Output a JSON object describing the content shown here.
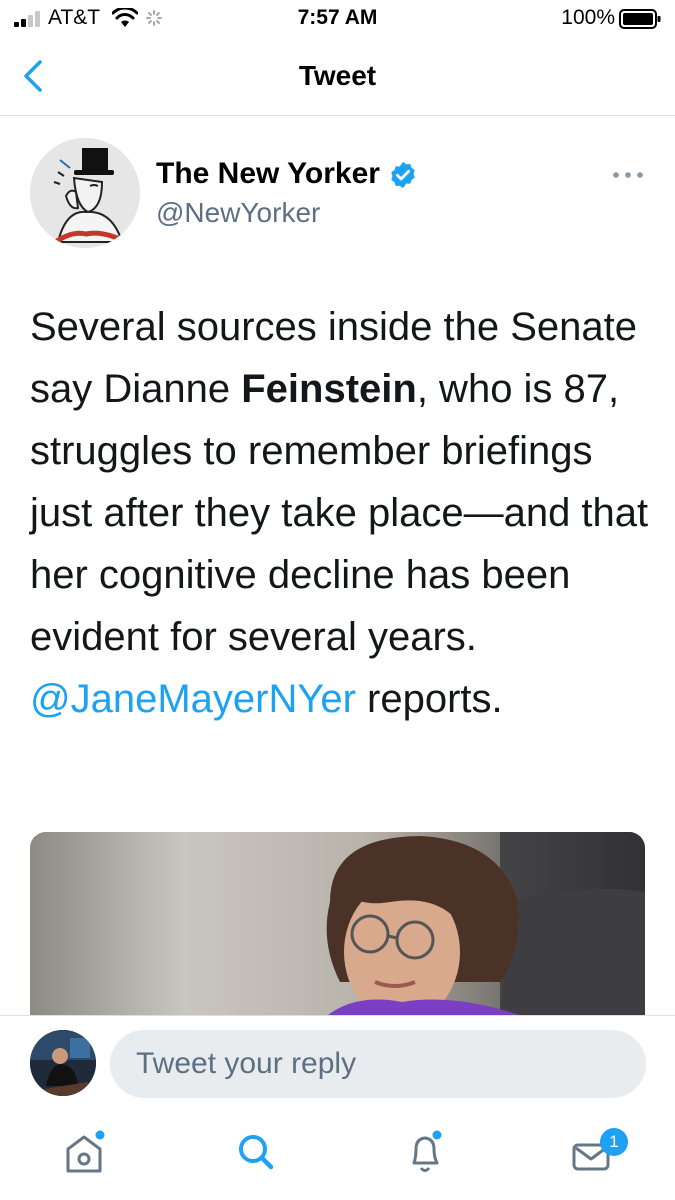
{
  "status_bar": {
    "carrier": "AT&T",
    "time": "7:57 AM",
    "battery": "100%"
  },
  "nav": {
    "title": "Tweet"
  },
  "tweet": {
    "author_name": "The New Yorker",
    "author_handle": "@NewYorker",
    "verified": true,
    "text_parts": {
      "p1": "Several sources inside the Senate say Dianne ",
      "p2_bold": "Feinstein",
      "p3": ", who is 87, struggles to remember briefings just after they take place—and that her cognitive decline has been evident for several years.",
      "mention": "@JaneMayerNYer",
      "p4": " reports."
    }
  },
  "reply": {
    "placeholder": "Tweet your reply"
  },
  "tabs": {
    "home": "home-icon",
    "search": "search-icon",
    "notifications": "bell-icon",
    "messages": "mail-icon",
    "messages_badge": "1"
  },
  "colors": {
    "accent": "#1da1f2",
    "secondary_text": "#5b7083",
    "badge": "#1da1f2"
  }
}
